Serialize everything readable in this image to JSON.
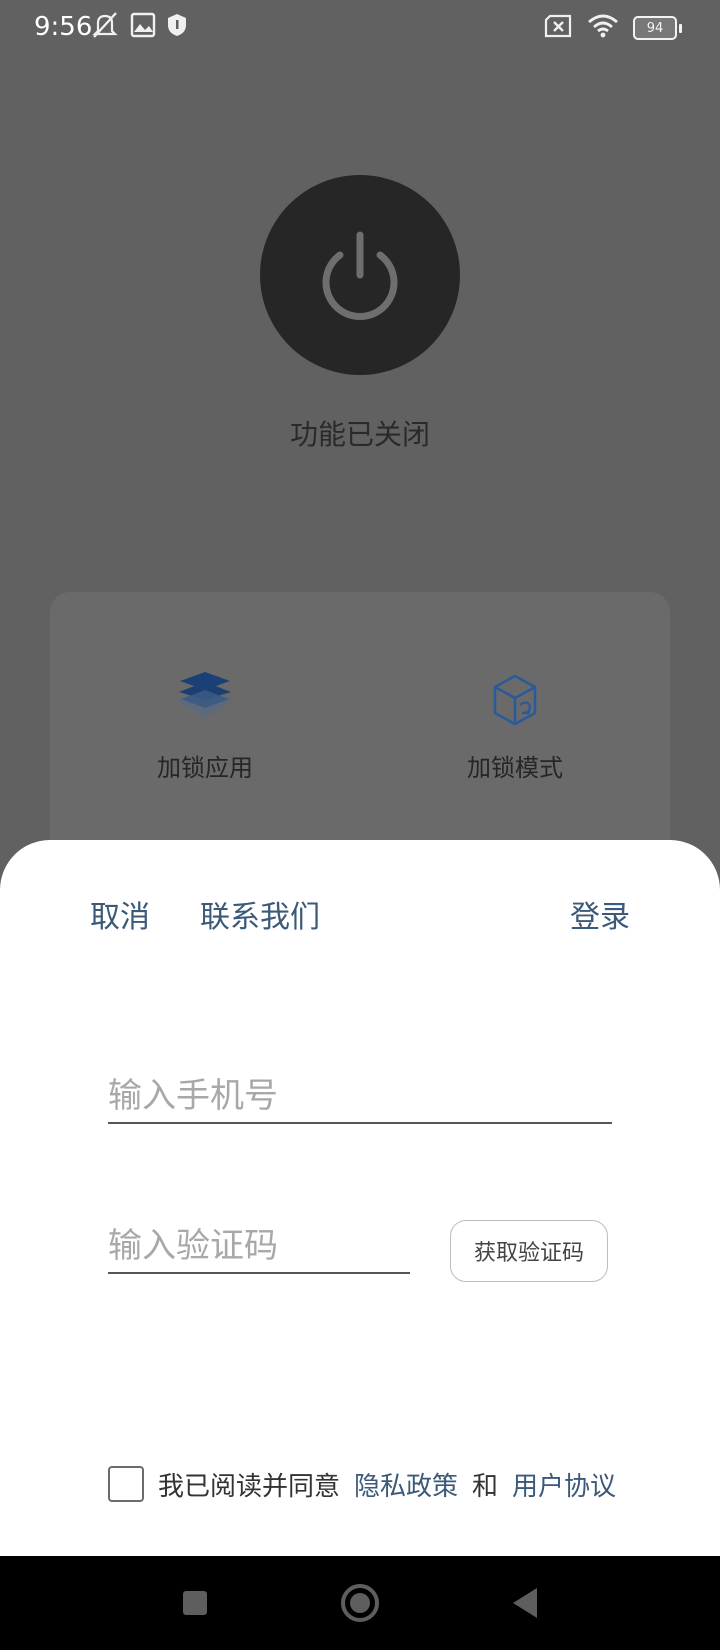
{
  "status_bar": {
    "time": "9:56",
    "battery": "94",
    "icons": [
      "mute-icon",
      "photo-icon",
      "shield-icon",
      "sim-x-icon",
      "wifi-icon",
      "battery-icon"
    ]
  },
  "background_app": {
    "status_text": "功能已关闭",
    "features": [
      {
        "label": "加锁应用",
        "icon": "layers-icon"
      },
      {
        "label": "加锁模式",
        "icon": "cube-icon"
      }
    ]
  },
  "login_sheet": {
    "cancel_label": "取消",
    "contact_label": "联系我们",
    "login_label": "登录",
    "phone_placeholder": "输入手机号",
    "phone_value": "",
    "code_placeholder": "输入验证码",
    "code_value": "",
    "get_code_label": "获取验证码",
    "agree_text": "我已阅读并同意",
    "privacy_label": "隐私政策",
    "and_text": "和",
    "terms_label": "用户协议",
    "agree_checked": false
  },
  "colors": {
    "link": "#3b5979",
    "sheet_bg": "#ffffff",
    "overlay_bg": "#616161"
  }
}
